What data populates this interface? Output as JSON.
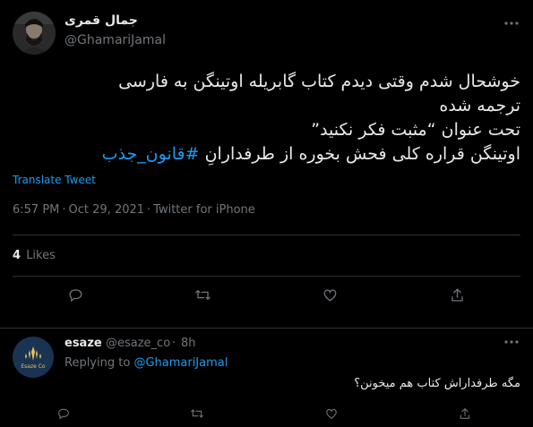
{
  "tweet": {
    "author_name": "جمال قمری",
    "author_handle": "@GhamariJamal",
    "text_lines": [
      "خوشحال شدم وقتی دیدم کتاب گابریله اوتینگن به فارسی",
      "ترجمه شده",
      "تحت عنوان “مثبت فکر نکنید”",
      "اوتینگن قراره کلی فحش بخوره از طرفدارانِ"
    ],
    "hashtag": "#قانون_جذب",
    "translate_label": "Translate Tweet",
    "time": "6:57 PM",
    "date": "Oct 29, 2021",
    "separator": "·",
    "source": "Twitter for iPhone",
    "likes_count": "4",
    "likes_label": "Likes"
  },
  "reply": {
    "author_name": "esaze",
    "author_handle": "@esaze_co",
    "separator": "·",
    "time": "8h",
    "replying_label": "Replying to",
    "replying_to": "@GhamariJamal",
    "text": "مگه طرفداراش کتاب هم میخونن؟",
    "avatar_text": "Esaze Co"
  },
  "icons": {
    "more": "more-icon",
    "reply": "reply-icon",
    "retweet": "retweet-icon",
    "like": "heart-icon",
    "share": "share-icon"
  },
  "colors": {
    "background": "#000000",
    "accent": "#1d9bf0",
    "muted": "#71767b",
    "text": "#e7e9ea"
  }
}
